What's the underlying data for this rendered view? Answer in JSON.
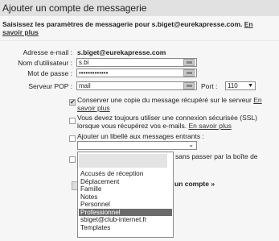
{
  "header": {
    "title": "Ajouter un compte de messagerie"
  },
  "instructions": {
    "text": "Saisissez les paramètres de messagerie pour s.biget@eurekapresse.com.",
    "link": "En savoir plus"
  },
  "form": {
    "email_label": "Adresse e-mail :",
    "email_value": "s.biget@eurekapresse.com",
    "username_label": "Nom d'utilisateur :",
    "username_value": "s.bi",
    "password_label": "Mot de passe :",
    "password_value": "•••••••••••••",
    "pop_label": "Serveur POP :",
    "pop_value": "mail",
    "port_label": "Port :",
    "port_value": "110"
  },
  "options": {
    "keep_copy": {
      "text": "Conserver une copie du message récupéré sur le serveur",
      "link": "En savoir plus",
      "checked": true
    },
    "ssl": {
      "text": "Vous devez toujours utiliser une connexion sécurisée (SSL) lorsque vous récupérez vos e-mails.",
      "link": "En savoir plus",
      "checked": false
    },
    "label": {
      "text": "Ajouter un libellé aux messages entrants :",
      "checked": false
    },
    "archive": {
      "text": "sans passer par la boîte de",
      "checked": false
    }
  },
  "label_list": {
    "items": [
      "Accusés de réception",
      "Déplacement",
      "Famille",
      "Notes",
      "Personnel",
      "Professionnel",
      "sbiget@club-internet.fr",
      "Templates"
    ],
    "selected": "Professionnel"
  },
  "partial_button": "un compte »",
  "colors": {
    "selected": "#6b6b6b",
    "header_bg": "#e1e1e1"
  }
}
